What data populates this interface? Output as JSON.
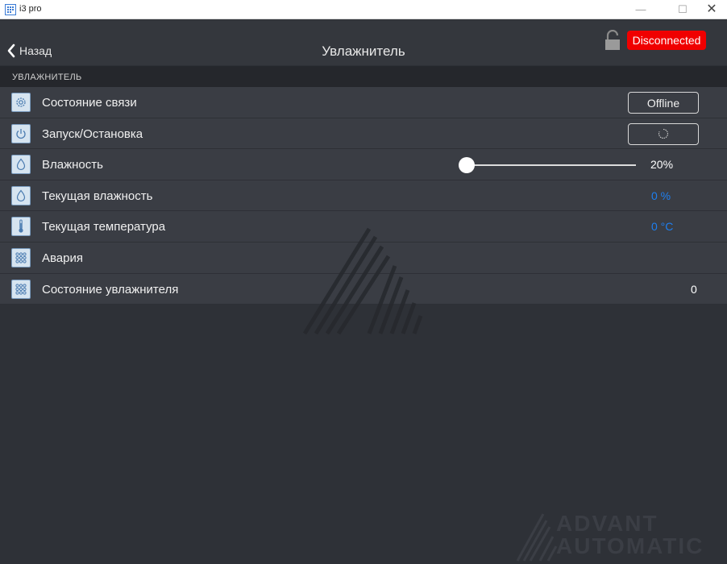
{
  "window": {
    "title": "i3 pro",
    "minimize_glyph": "—",
    "maximize_glyph": "☐",
    "close_glyph": "✕"
  },
  "header": {
    "back_label": "Назад",
    "title": "Увлажнитель",
    "status": "Disconnected",
    "status_color": "#f00000"
  },
  "section": {
    "title": "УВЛАЖНИТЕЛЬ"
  },
  "rows": [
    {
      "label": "Состояние связи",
      "icon": "gear-icon",
      "value": "Offline"
    },
    {
      "label": "Запуск/Остановка",
      "icon": "power-icon",
      "value": ""
    },
    {
      "label": "Влажность",
      "icon": "drop-icon",
      "value": "20%",
      "slider_fraction": 0.2
    },
    {
      "label": "Текущая влажность",
      "icon": "drop-icon",
      "value": "0 %"
    },
    {
      "label": "Текущая температура",
      "icon": "thermometer-icon",
      "value": "0 °C"
    },
    {
      "label": "Авария",
      "icon": "grid-icon",
      "value": ""
    },
    {
      "label": "Состояние увлажнителя",
      "icon": "grid-icon",
      "value": "0"
    }
  ],
  "watermark": {
    "line1": "ADVANT",
    "line2": "AUTOMATIC"
  },
  "colors": {
    "value_blue": "#1e7ff0",
    "background": "#2e3137"
  }
}
